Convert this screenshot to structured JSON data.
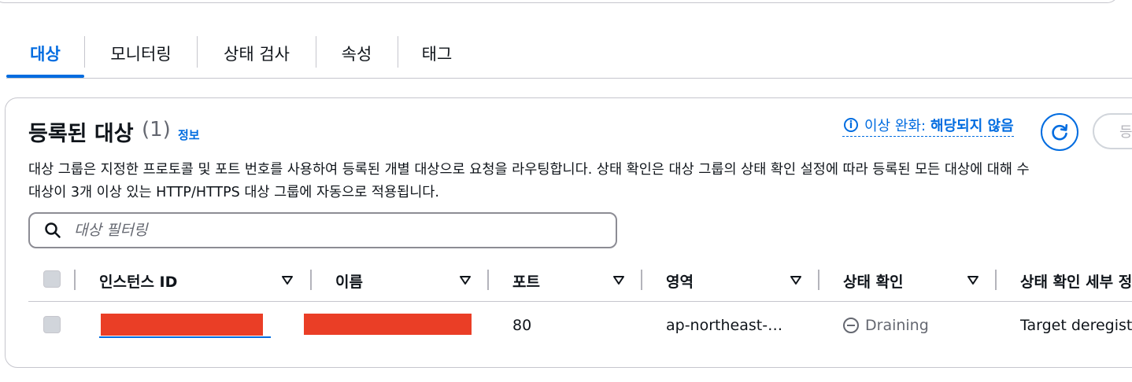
{
  "tabs": [
    {
      "label": "대상",
      "active": true
    },
    {
      "label": "모니터링",
      "active": false
    },
    {
      "label": "상태 검사",
      "active": false
    },
    {
      "label": "속성",
      "active": false
    },
    {
      "label": "태그",
      "active": false
    }
  ],
  "panel": {
    "title": "등록된 대상",
    "count": "(1)",
    "info_link": "정보",
    "anomaly_label": "이상 완화:",
    "anomaly_value": "해당되지 않음",
    "register_button": "등",
    "description_line1": "대상 그룹은 지정한 프로토콜 및 포트 번호를 사용하여 등록된 개별 대상으로 요청을 라우팅합니다. 상태 확인은 대상 그룹의 상태 확인 설정에 따라 등록된 모든 대상에 대해 수",
    "description_line2": "대상이 3개 이상 있는 HTTP/HTTPS 대상 그룹에 자동으로 적용됩니다."
  },
  "search": {
    "placeholder": "대상 필터링",
    "value": ""
  },
  "table": {
    "columns": [
      "인스턴스 ID",
      "이름",
      "포트",
      "영역",
      "상태 확인",
      "상태 확인 세부 정"
    ],
    "rows": [
      {
        "instance_id": "",
        "name": "",
        "port": "80",
        "zone": "ap-northeast-…",
        "health_status": "Draining",
        "health_detail": "Target deregist"
      }
    ]
  },
  "colors": {
    "accent": "#006ce0",
    "redaction": "#ea3e26",
    "muted": "#656871"
  }
}
